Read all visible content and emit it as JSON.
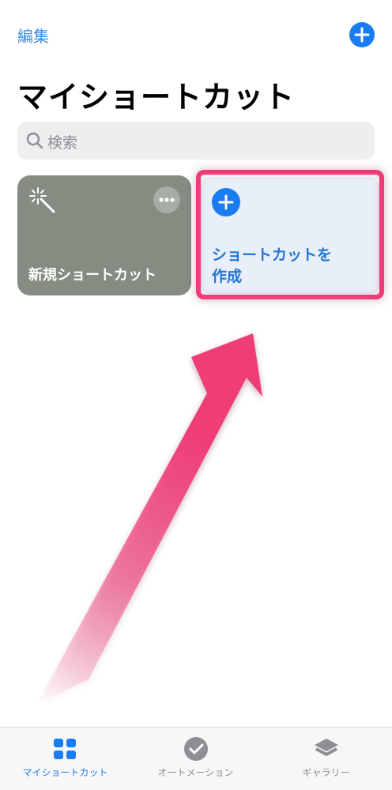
{
  "nav": {
    "edit_label": "編集",
    "add_icon": "plus-circle-icon"
  },
  "page": {
    "title": "マイショートカット"
  },
  "search": {
    "placeholder": "検索",
    "icon": "magnifier-icon"
  },
  "cards": {
    "new_shortcut": {
      "label": "新規ショートカット",
      "icon": "magic-wand-icon",
      "more_icon": "ellipsis-icon",
      "color": "#858c82"
    },
    "create_shortcut": {
      "label_line1": "ショートカットを",
      "label_line2": "作成",
      "icon": "plus-circle-icon",
      "color": "#e9eff8"
    }
  },
  "annotation": {
    "highlight_color": "#ef3c76",
    "arrow_color": "#ef3c76"
  },
  "tabbar": {
    "tabs": [
      {
        "label": "マイショートカット",
        "icon": "grid-icon",
        "active": true
      },
      {
        "label": "オートメーション",
        "icon": "checkmark-clock-icon",
        "active": false
      },
      {
        "label": "ギャラリー",
        "icon": "layers-icon",
        "active": false
      }
    ],
    "active_color": "#1a7cf3",
    "inactive_color": "#8e8e93"
  }
}
